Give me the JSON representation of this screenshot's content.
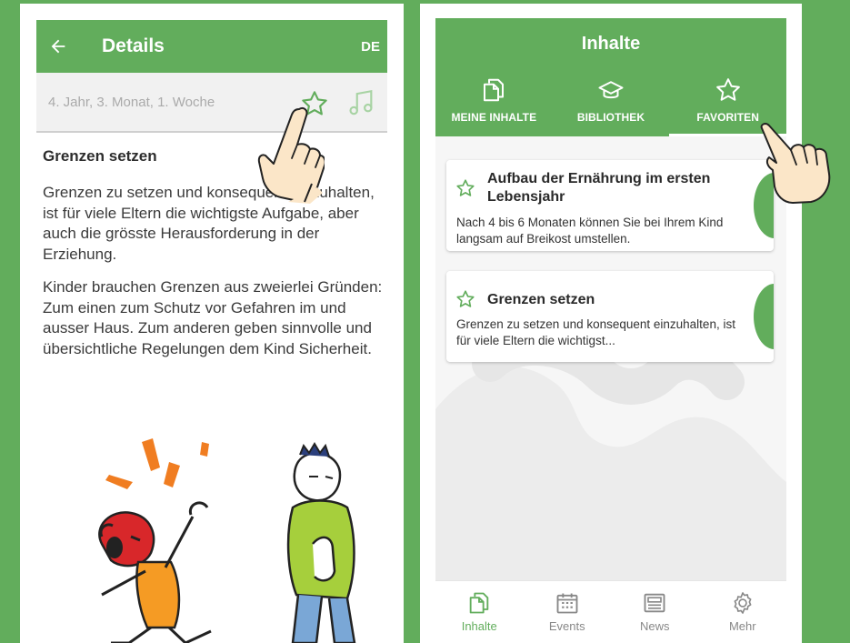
{
  "colors": {
    "brand": "#62ad5c",
    "background": "#62ad5c",
    "muted": "#aaaaaa",
    "text": "#333333"
  },
  "left_screen": {
    "appbar": {
      "title": "Details",
      "language": "DE",
      "back_icon": "arrow-left-icon"
    },
    "subbar": {
      "week_label": "4. Jahr, 3. Monat, 1. Woche",
      "favorite_icon": "star-outline-icon",
      "audio_icon": "music-note-icon"
    },
    "article": {
      "heading": "Grenzen setzen",
      "paragraphs": [
        "Grenzen zu setzen und konsequent einzuhalten, ist für viele Eltern die wichtigste Aufgabe, aber auch die grösste Herausforderung in der Erziehung.",
        "Kinder brauchen Grenzen aus zweierlei Gründen: Zum einen zum Schutz vor Gefahren im und ausser Haus. Zum anderen geben sinnvolle und übersichtliche Regelungen dem Kind Sicherheit."
      ]
    }
  },
  "right_screen": {
    "header": {
      "title": "Inhalte"
    },
    "tabs": [
      {
        "label": "MEINE INHALTE",
        "icon": "documents-icon",
        "active": false
      },
      {
        "label": "BIBLIOTHEK",
        "icon": "graduation-cap-icon",
        "active": false
      },
      {
        "label": "FAVORITEN",
        "icon": "star-outline-icon",
        "active": true
      }
    ],
    "favorites": [
      {
        "title": "Aufbau der Ernährung im ersten Lebensjahr",
        "text": "Nach 4 bis 6 Monaten können Sie bei Ihrem Kind langsam auf Breikost umstellen."
      },
      {
        "title": "Grenzen setzen",
        "text": "Grenzen zu setzen und konsequent einzuhalten, ist für viele Eltern die wichtigst..."
      }
    ],
    "bottom_nav": [
      {
        "label": "Inhalte",
        "icon": "documents-icon",
        "active": true
      },
      {
        "label": "Events",
        "icon": "calendar-icon",
        "active": false
      },
      {
        "label": "News",
        "icon": "newspaper-icon",
        "active": false
      },
      {
        "label": "Mehr",
        "icon": "gear-icon",
        "active": false
      }
    ]
  }
}
